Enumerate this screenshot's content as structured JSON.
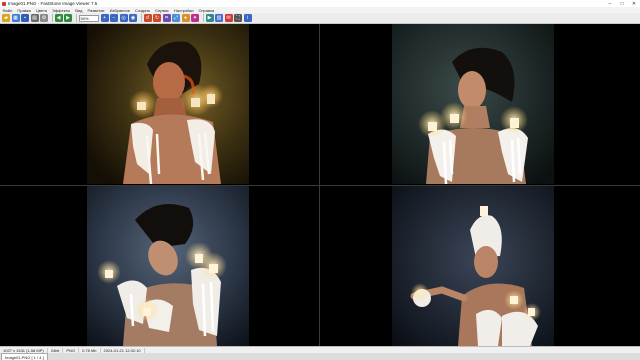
{
  "window": {
    "title": "Image01.PNG - FastStone Image Viewer 7.5",
    "minimize_label": "–",
    "maximize_label": "□",
    "close_label": "✕"
  },
  "menu": {
    "items": [
      {
        "label": "Файл"
      },
      {
        "label": "Правка"
      },
      {
        "label": "Цвета"
      },
      {
        "label": "Эффекты"
      },
      {
        "label": "Вид"
      },
      {
        "label": "Развитие"
      },
      {
        "label": "Избранное"
      },
      {
        "label": "Создать"
      },
      {
        "label": "Сервис"
      },
      {
        "label": "Настройки"
      },
      {
        "label": "Справка"
      }
    ]
  },
  "toolbar": {
    "zoom_value": "50%",
    "buttons": [
      {
        "icon": "open-folder-icon",
        "color": "#d9a324"
      },
      {
        "icon": "browser-icon",
        "color": "#3d7ad6"
      },
      {
        "icon": "save-icon",
        "color": "#2f5fb3"
      },
      {
        "icon": "print-icon",
        "color": "#6b6b6b"
      },
      {
        "icon": "settings-icon",
        "color": "#8a8a8a"
      },
      {
        "icon": "prev-icon",
        "color": "#2e8b3a"
      },
      {
        "icon": "next-icon",
        "color": "#2e8b3a"
      },
      {
        "icon": "zoom-in-icon",
        "color": "#3a66c4"
      },
      {
        "icon": "zoom-out-icon",
        "color": "#3a66c4"
      },
      {
        "icon": "actual-size-icon",
        "color": "#3a66c4"
      },
      {
        "icon": "fit-icon",
        "color": "#3a66c4"
      },
      {
        "icon": "rotate-left-icon",
        "color": "#c84a2b"
      },
      {
        "icon": "rotate-right-icon",
        "color": "#c84a2b"
      },
      {
        "icon": "crop-icon",
        "color": "#6d4bb0"
      },
      {
        "icon": "resize-icon",
        "color": "#4a8fd1"
      },
      {
        "icon": "color-icon",
        "color": "#d8902b"
      },
      {
        "icon": "effects-icon",
        "color": "#b8328a"
      },
      {
        "icon": "slideshow-icon",
        "color": "#2e8b8b"
      },
      {
        "icon": "compare-icon",
        "color": "#4b6bd0"
      },
      {
        "icon": "email-icon",
        "color": "#d03a3a"
      },
      {
        "icon": "fullscreen-icon",
        "color": "#555555"
      },
      {
        "icon": "info-icon",
        "color": "#3a66c4"
      }
    ]
  },
  "status": {
    "items": [
      "1027 x 1541 (1.58 MP)",
      "24bit",
      "PNG",
      "0.78 Mb",
      "2024-01-21 12:32:10"
    ]
  },
  "tabs": [
    {
      "label": "Image01.PNG [ 1 / 4 ]"
    }
  ]
}
